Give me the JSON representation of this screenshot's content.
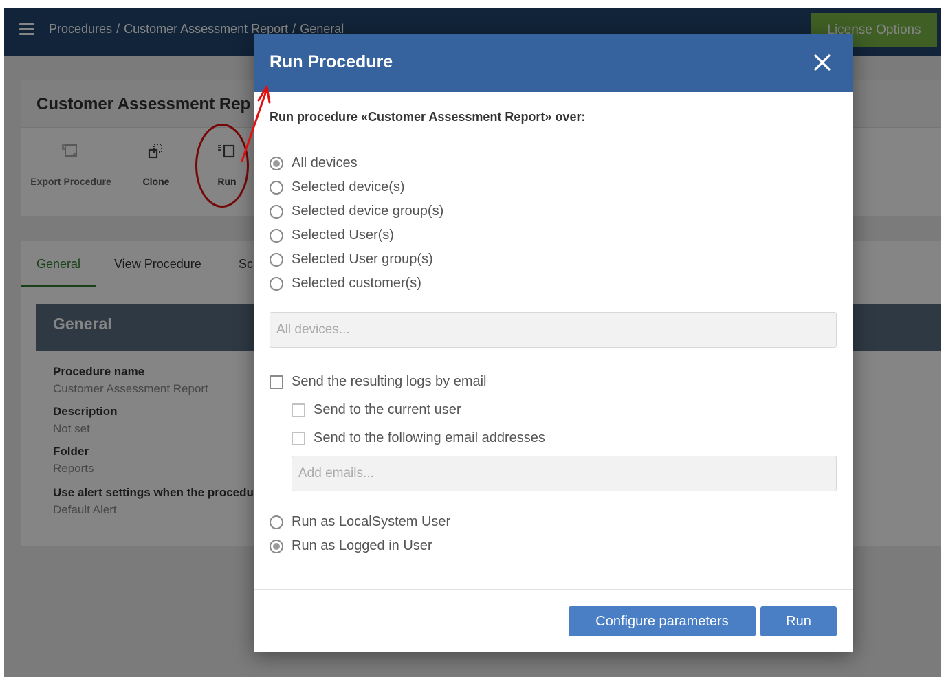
{
  "topbar": {
    "breadcrumb": [
      "Procedures",
      "Customer Assessment Report",
      "General"
    ],
    "breadcrumb_sep": "/",
    "license_label": "License Options"
  },
  "page": {
    "title": "Customer Assessment Rep",
    "toolbar": {
      "export_label": "Export Procedure",
      "clone_label": "Clone",
      "run_label": "Run"
    },
    "tabs": [
      "General",
      "View Procedure",
      "Sc"
    ],
    "general": {
      "panel_title": "General",
      "fields": [
        {
          "label": "Procedure name",
          "value": "Customer Assessment Report"
        },
        {
          "label": "Description",
          "value": "Not set"
        },
        {
          "label": "Folder",
          "value": "Reports"
        },
        {
          "label": "Use alert settings when the procedure",
          "value": "Default Alert"
        }
      ]
    }
  },
  "modal": {
    "title": "Run Procedure",
    "subtitle": "Run procedure «Customer Assessment Report» over:",
    "targets": [
      {
        "label": "All devices",
        "checked": true
      },
      {
        "label": "Selected device(s)",
        "checked": false
      },
      {
        "label": "Selected device group(s)",
        "checked": false
      },
      {
        "label": "Selected User(s)",
        "checked": false
      },
      {
        "label": "Selected User group(s)",
        "checked": false
      },
      {
        "label": "Selected customer(s)",
        "checked": false
      }
    ],
    "target_placeholder": "All devices...",
    "email": {
      "send_logs_label": "Send the resulting logs by email",
      "current_user_label": "Send to the current user",
      "following_label": "Send to the following email addresses",
      "emails_placeholder": "Add emails..."
    },
    "run_as": [
      {
        "label": "Run as LocalSystem User",
        "checked": false
      },
      {
        "label": "Run as Logged in User",
        "checked": true
      }
    ],
    "buttons": {
      "configure": "Configure parameters",
      "run": "Run"
    }
  },
  "colors": {
    "topbar": "#23456e",
    "modal_header": "#36629d",
    "primary_button": "#4a7fc6",
    "license_button": "#7ab648",
    "active_tab": "#2e7d32",
    "annotation": "#e01010"
  }
}
